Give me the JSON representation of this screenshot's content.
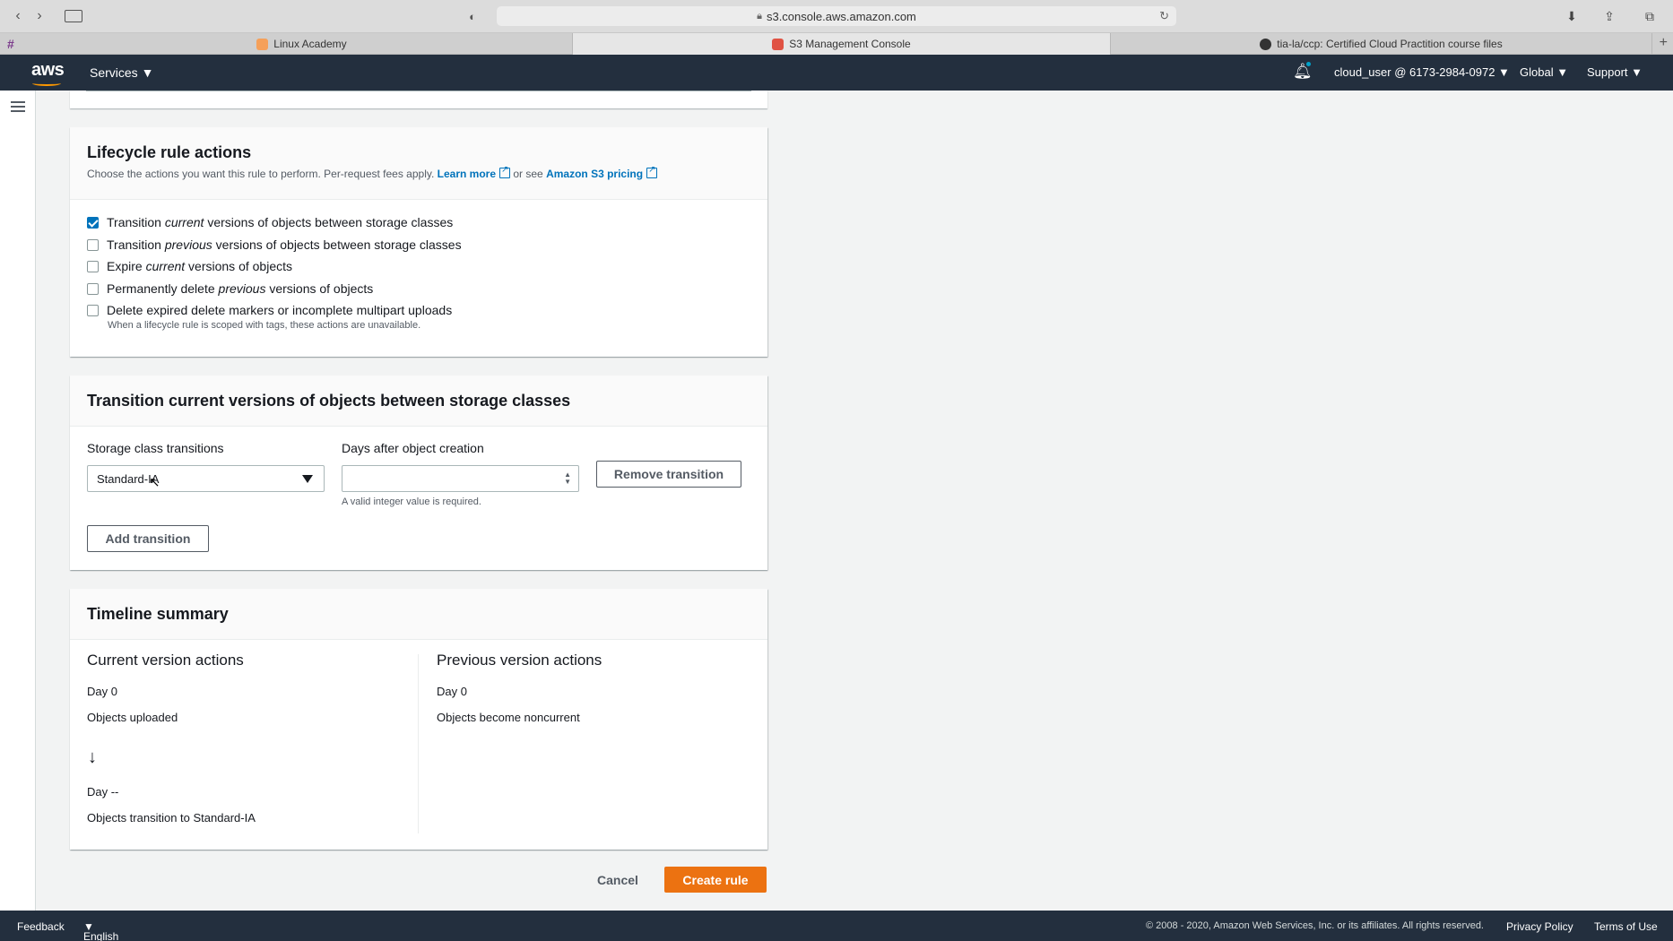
{
  "browser": {
    "url": "s3.console.aws.amazon.com",
    "tabs": [
      {
        "label": "Linux Academy"
      },
      {
        "label": "S3 Management Console"
      },
      {
        "label": "tia-la/ccp: Certified Cloud Practition course files"
      }
    ]
  },
  "aws_nav": {
    "logo": "aws",
    "services": "Services",
    "account": "cloud_user @ 6173-2984-0972",
    "region": "Global",
    "support": "Support"
  },
  "lifecycle": {
    "title": "Lifecycle rule actions",
    "desc_prefix": "Choose the actions you want this rule to perform. Per-request fees apply.",
    "learn_more": "Learn more",
    "or_see": "or see",
    "pricing": "Amazon S3 pricing",
    "options": [
      {
        "pre": "Transition",
        "em": "current",
        "post": "versions of objects between storage classes",
        "checked": true
      },
      {
        "pre": "Transition",
        "em": "previous",
        "post": "versions of objects between storage classes",
        "checked": false
      },
      {
        "pre": "Expire",
        "em": "current",
        "post": "versions of objects",
        "checked": false
      },
      {
        "pre": "Permanently delete",
        "em": "previous",
        "post": "versions of objects",
        "checked": false
      },
      {
        "pre": "Delete expired delete markers or incomplete multipart uploads",
        "em": "",
        "post": "",
        "checked": false
      }
    ],
    "hint": "When a lifecycle rule is scoped with tags, these actions are unavailable."
  },
  "transition": {
    "title": "Transition current versions of objects between storage classes",
    "storage_label": "Storage class transitions",
    "storage_value": "Standard-IA",
    "days_label": "Days after object creation",
    "days_value": "",
    "days_hint": "A valid integer value is required.",
    "remove_button": "Remove transition",
    "add_button": "Add transition"
  },
  "timeline": {
    "title": "Timeline summary",
    "current_title": "Current version actions",
    "current_day0": "Day 0",
    "current_uploaded": "Objects uploaded",
    "current_day_next": "Day --",
    "current_transition": "Objects transition to Standard-IA",
    "previous_title": "Previous version actions",
    "previous_day0": "Day 0",
    "previous_noncurrent": "Objects become noncurrent"
  },
  "actions": {
    "cancel": "Cancel",
    "create": "Create rule"
  },
  "footer": {
    "feedback": "Feedback",
    "language": "English (US)",
    "copyright": "© 2008 - 2020, Amazon Web Services, Inc. or its affiliates. All rights reserved.",
    "privacy": "Privacy Policy",
    "terms": "Terms of Use"
  },
  "colors": {
    "nav_bg": "#232f3e",
    "accent_orange": "#ec7211",
    "link_blue": "#0073bb"
  }
}
